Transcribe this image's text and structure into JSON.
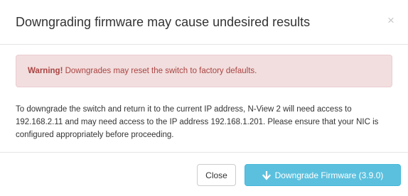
{
  "dialog": {
    "title": "Downgrading firmware may cause undesired results",
    "close_symbol": "×"
  },
  "alert": {
    "prefix": "Warning!",
    "message": " Downgrades may reset the switch to factory defaults."
  },
  "body": {
    "text": "To downgrade the switch and return it to the current IP address, N-View 2 will need access to 192.168.2.11 and may need access to the IP address 192.168.1.201. Please ensure that your NIC is configured appropriately before proceeding."
  },
  "footer": {
    "close_label": "Close",
    "downgrade_label": "Downgrade Firmware (3.9.0)",
    "downgrade_icon": "arrow-down-icon"
  },
  "colors": {
    "alert_bg": "#f2dede",
    "alert_text": "#a94442",
    "primary_btn": "#5bc0de"
  }
}
